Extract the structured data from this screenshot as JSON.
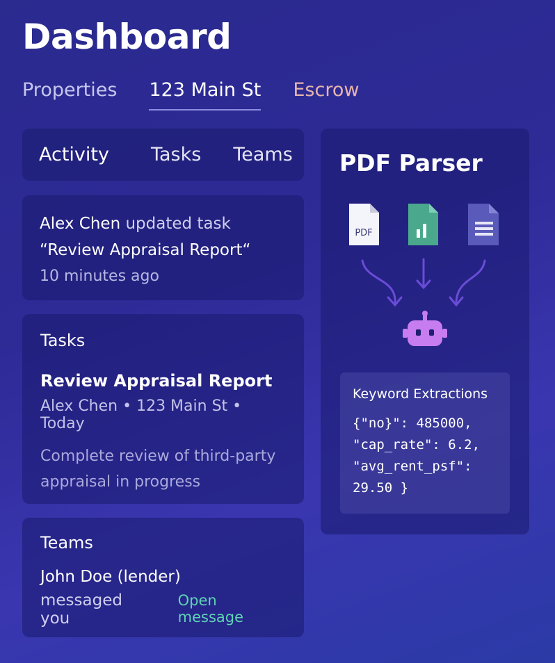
{
  "header": {
    "title": "Dashboard"
  },
  "top_tabs": [
    {
      "label": "Properties",
      "state": "inactive"
    },
    {
      "label": "123 Main St",
      "state": "active"
    },
    {
      "label": "Escrow",
      "state": "inactive"
    }
  ],
  "sub_tabs": [
    {
      "label": "Activity",
      "state": "active"
    },
    {
      "label": "Tasks",
      "state": "inactive"
    },
    {
      "label": "Teams",
      "state": "inactive"
    }
  ],
  "activity": {
    "user": "Alex Chen",
    "action": " updated task",
    "task": "“Review Appraisal Report“",
    "time": "10 minutes ago"
  },
  "tasks": {
    "title": "Tasks",
    "item_title": "Review Appraisal Report",
    "meta": "Alex Chen • 123 Main St • Today",
    "description": "Complete review of third-party appraisal in progress"
  },
  "teams": {
    "title": "Teams",
    "from": "John Doe (lender)",
    "message": "messaged you",
    "link": "Open message"
  },
  "parser": {
    "title": "PDF Parser",
    "pdf_icon_label": "PDF",
    "icons": [
      "pdf-file-icon",
      "spreadsheet-file-icon",
      "document-file-icon",
      "robot-icon"
    ],
    "keywords_title": "Keyword Extractions",
    "keywords_code": "{\"no}\": 485000,\n\"cap_rate\": 6.2,\n\"avg_rent_psf\":\n29.50 }"
  },
  "colors": {
    "accent_green": "#5fd3b4",
    "escrow_tab": "#e6b4ae",
    "robot": "#c77cf0",
    "arrows": "#6a4cd6"
  }
}
